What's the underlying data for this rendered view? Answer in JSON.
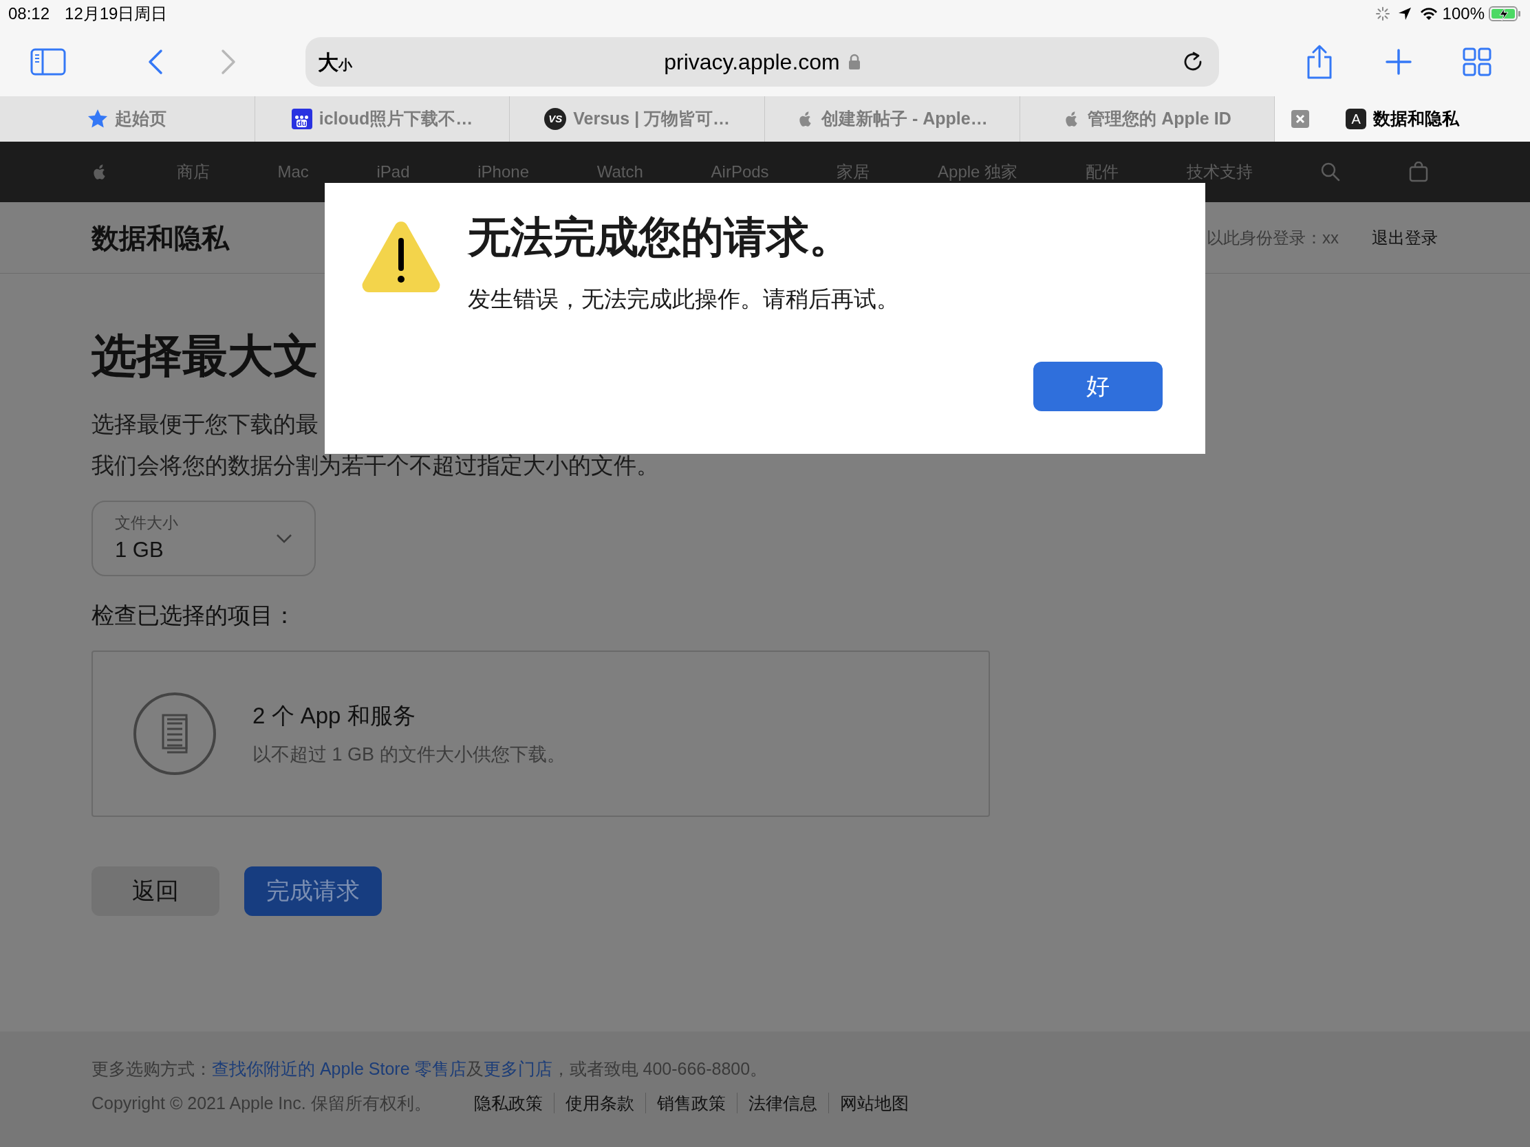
{
  "status_bar": {
    "time": "08:12",
    "date": "12月19日周日",
    "battery_text": "100%",
    "charging": true
  },
  "toolbar": {
    "address_prefix": "大小",
    "url": "privacy.apple.com",
    "secure": true
  },
  "tabs": [
    {
      "label": "起始页",
      "kind": "star",
      "selected": false
    },
    {
      "label": "icloud照片下载不…",
      "kind": "paw",
      "icon_text": "du",
      "selected": false
    },
    {
      "label": "Versus | 万物皆可…",
      "kind": "badge",
      "icon_text": "VS",
      "selected": false
    },
    {
      "label": "创建新帖子 - Apple…",
      "kind": "apple",
      "selected": false
    },
    {
      "label": "管理您的 Apple ID",
      "kind": "apple",
      "selected": false
    },
    {
      "label": "数据和隐私",
      "kind": "letter",
      "icon_text": "A",
      "selected": true
    }
  ],
  "nav": {
    "items": [
      "商店",
      "Mac",
      "iPad",
      "iPhone",
      "Watch",
      "AirPods",
      "家居",
      "Apple 独家",
      "配件",
      "技术支持"
    ]
  },
  "header": {
    "title": "数据和隐私",
    "signed_in": "以此身份登录：xx",
    "sign_out": "退出登录"
  },
  "main": {
    "heading": "选择最大文",
    "paragraph": [
      "选择最便于您下载的最",
      "我们会将您的数据分割为若干个不超过指定大小的文件。"
    ],
    "dropdown": {
      "label": "文件大小",
      "value": "1 GB"
    },
    "review_label": "检查已选择的项目：",
    "card": {
      "title": "2 个 App 和服务",
      "subtitle": "以不超过 1 GB 的文件大小供您下载。"
    },
    "buttons": [
      {
        "label": "返回",
        "kind": "secondary"
      },
      {
        "label": "完成请求",
        "kind": "primary"
      }
    ]
  },
  "footer": {
    "line": [
      {
        "kind": "text",
        "text": "更多选购方式："
      },
      {
        "kind": "link",
        "text": "查找你附近的 Apple Store 零售店"
      },
      {
        "kind": "text",
        "text": "及"
      },
      {
        "kind": "link",
        "text": "更多门店"
      },
      {
        "kind": "text",
        "text": "，或者致电 400-666-8800。"
      }
    ],
    "copyright": "Copyright © 2021 Apple Inc. 保留所有权利。",
    "links": [
      "隐私政策",
      "使用条款",
      "销售政策",
      "法律信息",
      "网站地图"
    ]
  },
  "dialog": {
    "title": "无法完成您的请求。",
    "message": "发生错误，无法完成此操作。请稍后再试。",
    "button": "好"
  }
}
